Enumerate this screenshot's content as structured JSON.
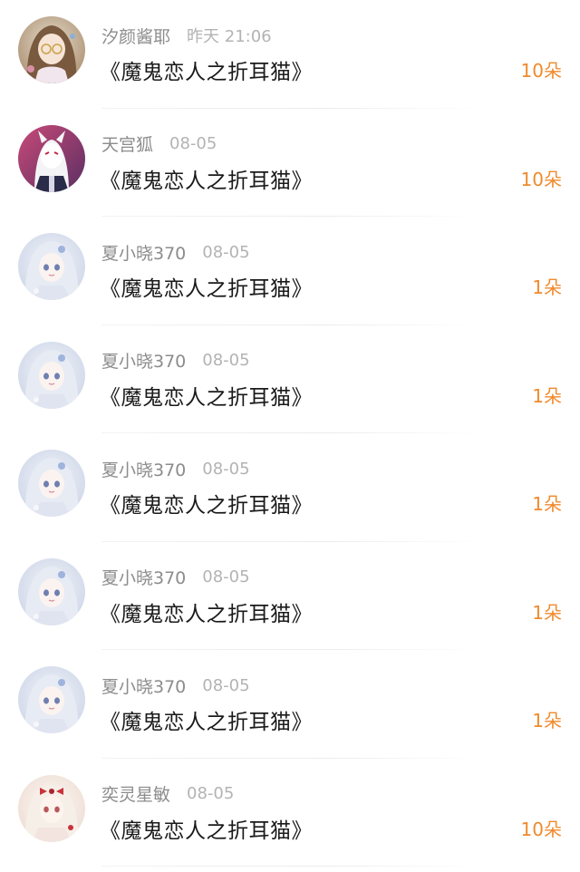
{
  "colors": {
    "username": "#8c8c8c",
    "time": "#b3b3b3",
    "title": "#1a1a1a",
    "gift": "#f08a2c",
    "divider": "#ececec"
  },
  "items": [
    {
      "username": "汐颜酱耶",
      "time": "昨天 21:06",
      "title": "《魔鬼恋人之折耳猫》",
      "gift": "10朵",
      "avatar_icon": "girl-glasses-avatar"
    },
    {
      "username": "天宫狐",
      "time": "08-05",
      "title": "《魔鬼恋人之折耳猫》",
      "gift": "10朵",
      "avatar_icon": "fox-mask-avatar"
    },
    {
      "username": "夏小晓370",
      "time": "08-05",
      "title": "《魔鬼恋人之折耳猫》",
      "gift": "1朵",
      "avatar_icon": "white-hair-girl-avatar"
    },
    {
      "username": "夏小晓370",
      "time": "08-05",
      "title": "《魔鬼恋人之折耳猫》",
      "gift": "1朵",
      "avatar_icon": "white-hair-girl-avatar"
    },
    {
      "username": "夏小晓370",
      "time": "08-05",
      "title": "《魔鬼恋人之折耳猫》",
      "gift": "1朵",
      "avatar_icon": "white-hair-girl-avatar"
    },
    {
      "username": "夏小晓370",
      "time": "08-05",
      "title": "《魔鬼恋人之折耳猫》",
      "gift": "1朵",
      "avatar_icon": "white-hair-girl-avatar"
    },
    {
      "username": "夏小晓370",
      "time": "08-05",
      "title": "《魔鬼恋人之折耳猫》",
      "gift": "1朵",
      "avatar_icon": "white-hair-girl-avatar"
    },
    {
      "username": "奕灵星敏",
      "time": "08-05",
      "title": "《魔鬼恋人之折耳猫》",
      "gift": "10朵",
      "avatar_icon": "red-bow-girl-avatar"
    }
  ]
}
